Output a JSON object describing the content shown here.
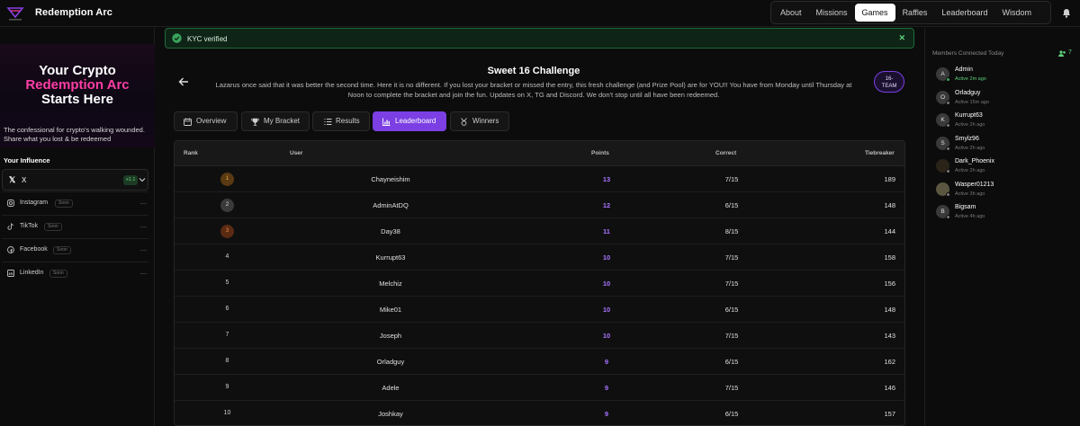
{
  "nav": {
    "brand": "Redemption Arc",
    "items": [
      {
        "label": "About",
        "active": false
      },
      {
        "label": "Missions",
        "active": false
      },
      {
        "label": "Games",
        "active": true
      },
      {
        "label": "Raffles",
        "active": false
      },
      {
        "label": "Leaderboard",
        "active": false
      },
      {
        "label": "Wisdom",
        "active": false
      }
    ],
    "icons": {
      "logo": "redemption-arc-logo",
      "bell": "bell-icon"
    }
  },
  "sidebar": {
    "promo": {
      "line1": "Your Crypto",
      "line2": "Redemption Arc",
      "line3": "Starts Here",
      "accent": "#ff3ea5"
    },
    "tagline": "The confessional for crypto's walking wounded. Share what you lost & be redeemed",
    "influence_title": "Your Influence",
    "x": {
      "label": "X",
      "badge": "x1.1"
    },
    "others": [
      {
        "label": "Instagram",
        "soon": "Soon",
        "icon": "instagram-icon"
      },
      {
        "label": "TikTok",
        "soon": "Soon",
        "icon": "tiktok-icon"
      },
      {
        "label": "Facebook",
        "soon": "Soon",
        "icon": "facebook-icon"
      },
      {
        "label": "LinkedIn",
        "soon": "Soon",
        "icon": "linkedin-icon"
      }
    ]
  },
  "toast": {
    "message": "KYC verified",
    "color": "#5fd07a"
  },
  "challenge": {
    "title": "Sweet 16 Challenge",
    "description": "Lazarus once said that it was better the second time. Here it is no different. If you lost your bracket or missed the entry, this fresh challenge (and Prize Pool) are for YOU!! You have from Monday until Thursday at Noon to complete the bracket and join the fun. Updates on X, TG and Discord. We don't stop until all have been redeemed.",
    "badge_line1": "16-",
    "badge_line2": "TEAM"
  },
  "tabs": [
    {
      "label": "Overview",
      "active": false,
      "icon": "calendar-icon"
    },
    {
      "label": "My Bracket",
      "active": false,
      "icon": "trophy-icon"
    },
    {
      "label": "Results",
      "active": false,
      "icon": "list-icon"
    },
    {
      "label": "Leaderboard",
      "active": true,
      "icon": "bar-chart-icon"
    },
    {
      "label": "Winners",
      "active": false,
      "icon": "medal-icon"
    }
  ],
  "table": {
    "headers": {
      "rank": "Rank",
      "user": "User",
      "points": "Points",
      "correct": "Correct",
      "tiebreaker": "Tiebreaker"
    },
    "rows": [
      {
        "rank": "1",
        "user": "Chayneishim",
        "points": "13",
        "correct": "7/15",
        "tiebreaker": "189"
      },
      {
        "rank": "2",
        "user": "AdminAtDQ",
        "points": "12",
        "correct": "6/15",
        "tiebreaker": "148"
      },
      {
        "rank": "3",
        "user": "Day38",
        "points": "11",
        "correct": "8/15",
        "tiebreaker": "144"
      },
      {
        "rank": "4",
        "user": "Kurrupt63",
        "points": "10",
        "correct": "7/15",
        "tiebreaker": "158"
      },
      {
        "rank": "5",
        "user": "Melchiz",
        "points": "10",
        "correct": "7/15",
        "tiebreaker": "156"
      },
      {
        "rank": "6",
        "user": "Mike01",
        "points": "10",
        "correct": "6/15",
        "tiebreaker": "148"
      },
      {
        "rank": "7",
        "user": "Joseph",
        "points": "10",
        "correct": "7/15",
        "tiebreaker": "143"
      },
      {
        "rank": "8",
        "user": "Orladguy",
        "points": "9",
        "correct": "6/15",
        "tiebreaker": "162"
      },
      {
        "rank": "9",
        "user": "Adele",
        "points": "9",
        "correct": "7/15",
        "tiebreaker": "146"
      },
      {
        "rank": "10",
        "user": "Joshkay",
        "points": "9",
        "correct": "6/15",
        "tiebreaker": "157"
      }
    ]
  },
  "members": {
    "title": "Members Connected Today",
    "count": "7",
    "list": [
      {
        "initial": "A",
        "name": "Admin",
        "active": "Active 2m ago",
        "online": true
      },
      {
        "initial": "O",
        "name": "Orladguy",
        "active": "Active 15m ago",
        "online": false
      },
      {
        "initial": "K",
        "name": "Kurrupt63",
        "active": "Active 2h ago",
        "online": false
      },
      {
        "initial": "S",
        "name": "Smylz96",
        "active": "Active 2h ago",
        "online": false
      },
      {
        "initial": "",
        "name": "Dark_Phoenix",
        "active": "Active 2h ago",
        "online": false
      },
      {
        "initial": "",
        "name": "Wasper01213",
        "active": "Active 3h ago",
        "online": false
      },
      {
        "initial": "B",
        "name": "Bigsam",
        "active": "Active 4h ago",
        "online": false
      }
    ]
  }
}
